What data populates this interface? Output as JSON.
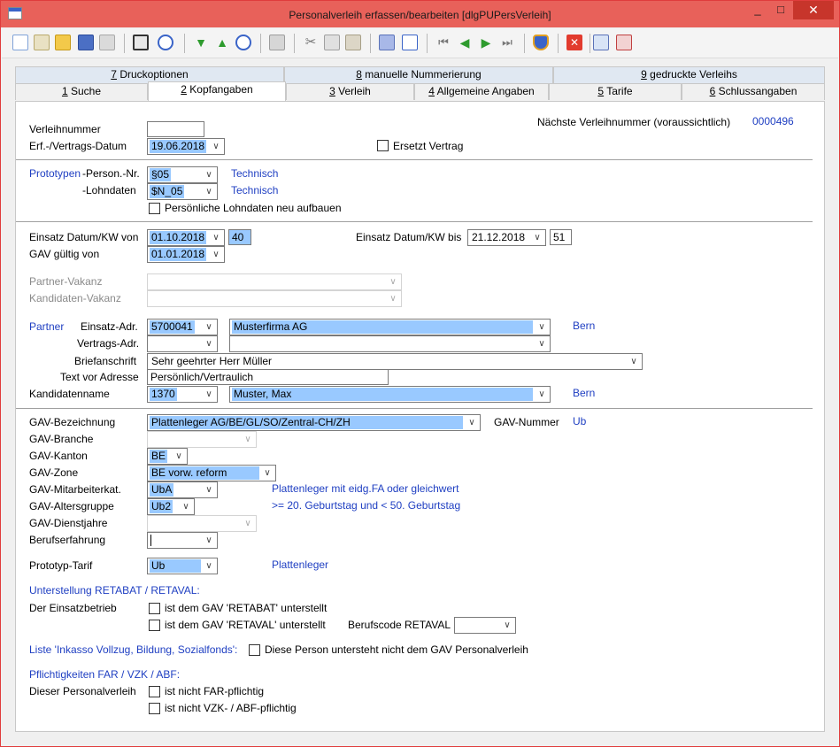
{
  "window": {
    "title": "Personalverleih erfassen/bearbeiten [dlgPUPersVerleih]",
    "min": "_",
    "max": "□",
    "close": "✕"
  },
  "tabs_row1": [
    {
      "num": "7",
      "label": " Druckoptionen"
    },
    {
      "num": "8",
      "label": " manuelle Nummerierung"
    },
    {
      "num": "9",
      "label": " gedruckte Verleihs"
    }
  ],
  "tabs_row2": [
    {
      "num": "1",
      "label": " Suche"
    },
    {
      "num": "2",
      "label": " Kopfangaben"
    },
    {
      "num": "3",
      "label": " Verleih"
    },
    {
      "num": "4",
      "label": " Allgemeine Angaben"
    },
    {
      "num": "5",
      "label": " Tarife"
    },
    {
      "num": "6",
      "label": " Schlussangaben"
    }
  ],
  "head": {
    "verleihnummer_label": "Verleihnummer",
    "verleihnummer_value": "",
    "next_label": "Nächste Verleihnummer (voraussichtlich)",
    "next_value": "0000496",
    "erf_label": "Erf.-/Vertrags-Datum",
    "erf_value": "19.06.2018",
    "ersetzt_label": "Ersetzt Vertrag"
  },
  "proto": {
    "section_label": "Prototypen",
    "person_label": "-Person.-Nr.",
    "person_value": "§05",
    "person_info": "Technisch",
    "lohn_label": "-Lohndaten",
    "lohn_value": "$N_05",
    "lohn_info": "Technisch",
    "rebuild_label": "Persönliche Lohndaten neu aufbauen"
  },
  "einsatz": {
    "von_label": "Einsatz Datum/KW von",
    "von_date": "01.10.2018",
    "von_kw": "40",
    "bis_label": "Einsatz Datum/KW bis",
    "bis_date": "21.12.2018",
    "bis_kw": "51",
    "gav_label": "GAV gültig von",
    "gav_value": "01.01.2018",
    "partner_vakanz_label": "Partner-Vakanz",
    "kand_vakanz_label": "Kandidaten-Vakanz"
  },
  "partner": {
    "section_label": "Partner",
    "einsatz_label": "Einsatz-Adr.",
    "einsatz_nr": "5700041",
    "einsatz_name": "Musterfirma AG",
    "einsatz_ort": "Bern",
    "vertrag_label": "Vertrags-Adr.",
    "brief_label": "Briefanschrift",
    "brief_value": "Sehr geehrter Herr Müller",
    "textvor_label": "Text vor Adresse",
    "textvor_value": "Persönlich/Vertraulich",
    "kand_label": "Kandidatenname",
    "kand_nr": "1370",
    "kand_name": "Muster, Max",
    "kand_ort": "Bern"
  },
  "gav": {
    "bez_label": "GAV-Bezeichnung",
    "bez_value": "Plattenleger AG/BE/GL/SO/Zentral-CH/ZH",
    "nummer_label": "GAV-Nummer",
    "nummer_value": "Ub",
    "branche_label": "GAV-Branche",
    "kanton_label": "GAV-Kanton",
    "kanton_value": "BE",
    "zone_label": "GAV-Zone",
    "zone_value": "BE vorw. reform",
    "mak_label": "GAV-Mitarbeiterkat.",
    "mak_value": "UbA",
    "mak_info": "Plattenleger mit eidg.FA oder gleichwert",
    "alter_label": "GAV-Altersgruppe",
    "alter_value": "Ub2",
    "alter_info": ">= 20. Geburtstag und < 50. Geburtstag",
    "dienst_label": "GAV-Dienstjahre",
    "beruf_label": "Berufserfahrung",
    "tarif_label": "Prototyp-Tarif",
    "tarif_value": "Ub",
    "tarif_info": "Plattenleger"
  },
  "retabat": {
    "section_label": "Unterstellung RETABAT / RETAVAL:",
    "betrieb_label": "Der Einsatzbetrieb",
    "chk1_label": "ist dem GAV 'RETABAT' unterstellt",
    "chk2_label": "ist dem GAV 'RETAVAL' unterstellt",
    "code_label": "Berufscode RETAVAL"
  },
  "inkasso": {
    "section_label": "Liste 'Inkasso Vollzug, Bildung, Sozialfonds':",
    "chk_label": "Diese Person untersteht nicht dem GAV Personalverleih"
  },
  "far": {
    "section_label": "Pflichtigkeiten FAR / VZK / ABF:",
    "verleih_label": "Dieser Personalverleih",
    "chk1_label": "ist nicht FAR-pflichtig",
    "chk2_label": "ist nicht VZK- / ABF-pflichtig"
  },
  "colors": {
    "titlebar": "#e8615a",
    "highlight": "#99c9ff",
    "link_blue": "#1f3fc2"
  },
  "toolbar_icons": [
    "new-icon",
    "open-icon",
    "folder-icon",
    "save-icon",
    "print-preview-icon",
    "layout-icon",
    "search-icon",
    "arrow-down-icon",
    "arrow-up-icon",
    "find-icon",
    "printer-icon",
    "cut-icon",
    "copy-icon",
    "paste-icon",
    "list-icon",
    "edit-icon",
    "first-icon",
    "prev-icon",
    "next-icon",
    "last-icon",
    "shield-icon",
    "delete-icon",
    "refresh-icon",
    "cancel-icon"
  ]
}
